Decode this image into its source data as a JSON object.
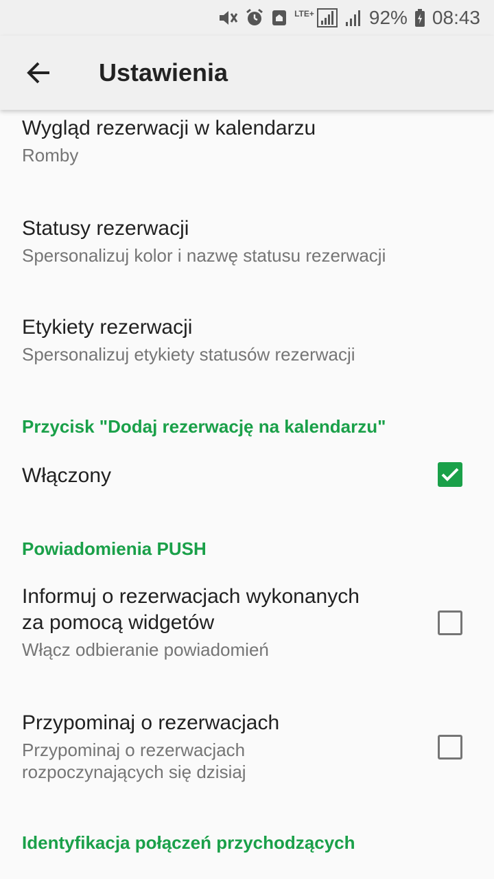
{
  "status_bar": {
    "network": "LTE+",
    "battery": "92%",
    "time": "08:43",
    "icons": [
      "mute-icon",
      "alarm-icon",
      "home-notification-icon",
      "signal-icon",
      "signal-icon-2",
      "battery-charging-icon"
    ]
  },
  "app_bar": {
    "title": "Ustawienia",
    "back_icon": "arrow-back-icon"
  },
  "colors": {
    "accent": "#1aa049",
    "title_text": "#212121",
    "summary_text": "#757575"
  },
  "prefs": {
    "calendar_look": {
      "title": "Wygląd rezerwacji w kalendarzu",
      "summary": "Romby"
    },
    "statuses": {
      "title": "Statusy rezerwacji",
      "summary": "Spersonalizuj kolor i nazwę statusu rezerwacji"
    },
    "labels": {
      "title": "Etykiety rezerwacji",
      "summary": "Spersonalizuj etykiety statusów rezerwacji"
    }
  },
  "section_add_button": {
    "header": "Przycisk \"Dodaj rezerwację na kalendarzu\"",
    "enabled": {
      "title": "Włączony",
      "checked": true
    }
  },
  "section_push": {
    "header": "Powiadomienia PUSH",
    "widgets": {
      "title_line1": "Informuj o rezerwacjach wykonanych",
      "title_line2": "za pomocą widgetów",
      "summary": "Włącz odbieranie powiadomień",
      "checked": false
    },
    "remind": {
      "title": "Przypominaj o rezerwacjach",
      "summary_line1": "Przypominaj o rezerwacjach",
      "summary_line2": "rozpoczynających się dzisiaj",
      "checked": false
    }
  },
  "section_calls": {
    "header": "Identyfikacja połączeń przychodzących"
  }
}
